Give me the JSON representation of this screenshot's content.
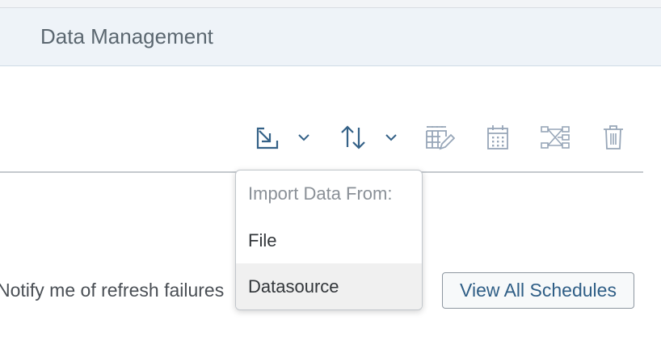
{
  "header": {
    "title": "Data Management"
  },
  "toolbar": {
    "buttons": [
      {
        "name": "import-data-icon",
        "state": "enabled"
      },
      {
        "name": "chevron-down-icon"
      },
      {
        "name": "sort-icon",
        "state": "enabled"
      },
      {
        "name": "chevron-down-icon"
      },
      {
        "name": "edit-table-icon",
        "state": "disabled"
      },
      {
        "name": "calendar-icon",
        "state": "disabled"
      },
      {
        "name": "workflow-icon",
        "state": "disabled"
      },
      {
        "name": "trash-icon",
        "state": "disabled"
      }
    ]
  },
  "import_menu": {
    "header": "Import Data From:",
    "items": [
      {
        "label": "File"
      },
      {
        "label": "Datasource",
        "hovered": true
      }
    ]
  },
  "notify": {
    "label": "Notify me of refresh failures"
  },
  "view_all_schedules": {
    "label": "View All Schedules"
  },
  "colors": {
    "accent": "#2f5e86",
    "header_bg": "#eef3f8",
    "icon_enabled": "#346187",
    "icon_disabled": "#97a6b8"
  }
}
